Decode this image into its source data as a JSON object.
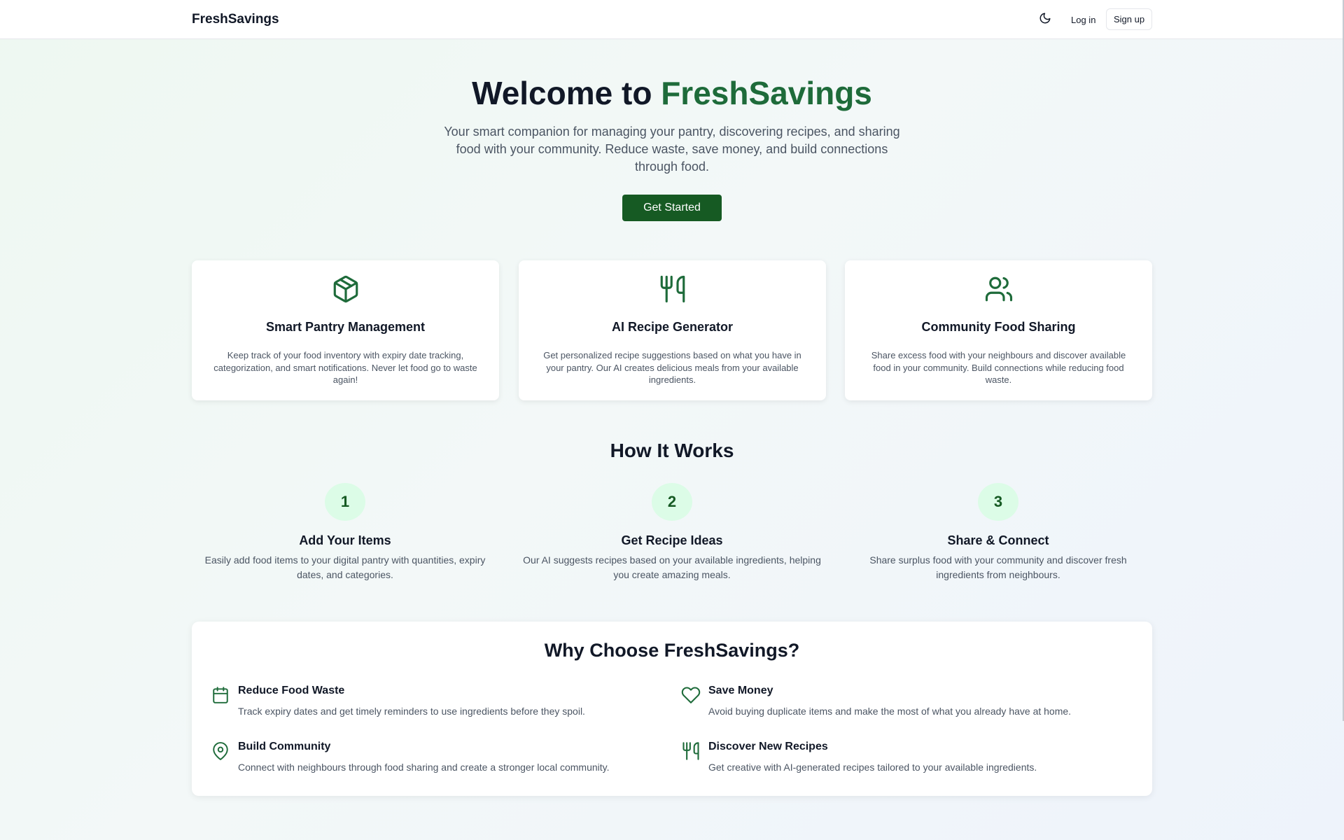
{
  "header": {
    "brand": "FreshSavings",
    "theme_icon": "moon-icon",
    "login_label": "Log in",
    "signup_label": "Sign up"
  },
  "hero": {
    "title_prefix": "Welcome to",
    "title_accent": "FreshSavings",
    "subtitle": "Your smart companion for managing your pantry, discovering recipes, and sharing food with your community. Reduce waste, save money, and build connections through food.",
    "cta_label": "Get Started"
  },
  "features": [
    {
      "icon": "package-icon",
      "title": "Smart Pantry Management",
      "description": "Keep track of your food inventory with expiry date tracking, categorization, and smart notifications. Never let food go to waste again!"
    },
    {
      "icon": "utensils-icon",
      "title": "AI Recipe Generator",
      "description": "Get personalized recipe suggestions based on what you have in your pantry. Our AI creates delicious meals from your available ingredients."
    },
    {
      "icon": "users-icon",
      "title": "Community Food Sharing",
      "description": "Share excess food with your neighbours and discover available food in your community. Build connections while reducing food waste."
    }
  ],
  "how_it_works": {
    "title": "How It Works",
    "steps": [
      {
        "number": "1",
        "title": "Add Your Items",
        "description": "Easily add food items to your digital pantry with quantities, expiry dates, and categories."
      },
      {
        "number": "2",
        "title": "Get Recipe Ideas",
        "description": "Our AI suggests recipes based on your available ingredients, helping you create amazing meals."
      },
      {
        "number": "3",
        "title": "Share & Connect",
        "description": "Share surplus food with your community and discover fresh ingredients from neighbours."
      }
    ]
  },
  "why": {
    "title": "Why Choose FreshSavings?",
    "benefits": [
      {
        "icon": "calendar-icon",
        "title": "Reduce Food Waste",
        "description": "Track expiry dates and get timely reminders to use ingredients before they spoil."
      },
      {
        "icon": "heart-icon",
        "title": "Save Money",
        "description": "Avoid buying duplicate items and make the most of what you already have at home."
      },
      {
        "icon": "map-pin-icon",
        "title": "Build Community",
        "description": "Connect with neighbours through food sharing and create a stronger local community."
      },
      {
        "icon": "utensils-icon",
        "title": "Discover New Recipes",
        "description": "Get creative with AI-generated recipes tailored to your available ingredients."
      }
    ]
  },
  "colors": {
    "accent": "#1e6b3a",
    "button": "#165a23",
    "step_circle": "#dcfce7"
  }
}
